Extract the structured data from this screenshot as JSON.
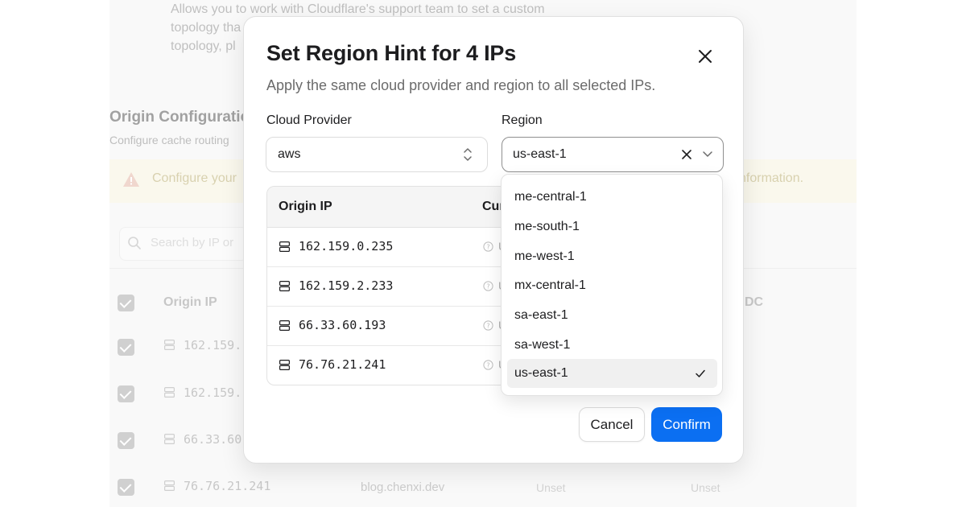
{
  "background": {
    "intro_lines": [
      "Allows you to work with Cloudflare's support team to set a custom",
      "topology tha",
      "topology, pl"
    ],
    "section_title": "Origin Configuration",
    "section_subtitle": "Configure cache routing",
    "alert": {
      "text": "Configure your",
      "tail": "nformation.",
      "icon": "warning-triangle-icon"
    },
    "search_placeholder": "Search by IP or",
    "table": {
      "col_origin_ip": "Origin IP",
      "col_dc": "DC",
      "rows": [
        {
          "ip": "162.159.",
          "host": "",
          "status": "",
          "dc": ""
        },
        {
          "ip": "162.159.",
          "host": "",
          "status": "",
          "dc": ""
        },
        {
          "ip": "66.33.60",
          "host": "",
          "status": "",
          "dc": ""
        },
        {
          "ip": "76.76.21.241",
          "host": "blog.chenxi.dev",
          "status": "Unset",
          "dc": "Unset"
        }
      ]
    }
  },
  "modal": {
    "title": "Set Region Hint for 4 IPs",
    "description": "Apply the same cloud provider and region to all selected IPs.",
    "provider_label": "Cloud Provider",
    "provider_value": "aws",
    "region_label": "Region",
    "region_value": "us-east-1",
    "table": {
      "col_origin_ip": "Origin IP",
      "col_current": "Cur",
      "rows": [
        {
          "ip": "162.159.0.235",
          "cut": "U"
        },
        {
          "ip": "162.159.2.233",
          "cut": "U"
        },
        {
          "ip": "66.33.60.193",
          "cut": "U"
        },
        {
          "ip": "76.76.21.241",
          "cut": "U"
        }
      ]
    },
    "cancel_label": "Cancel",
    "confirm_label": "Confirm"
  },
  "dropdown": {
    "options": [
      "me-central-1",
      "me-south-1",
      "me-west-1",
      "mx-central-1",
      "sa-east-1",
      "sa-west-1",
      "us-east-1"
    ],
    "selected": "us-east-1"
  },
  "colors": {
    "accent": "#0b6ff2",
    "warning_bg": "#f6f3df",
    "overlay": "rgba(255,255,255,0.45)"
  }
}
